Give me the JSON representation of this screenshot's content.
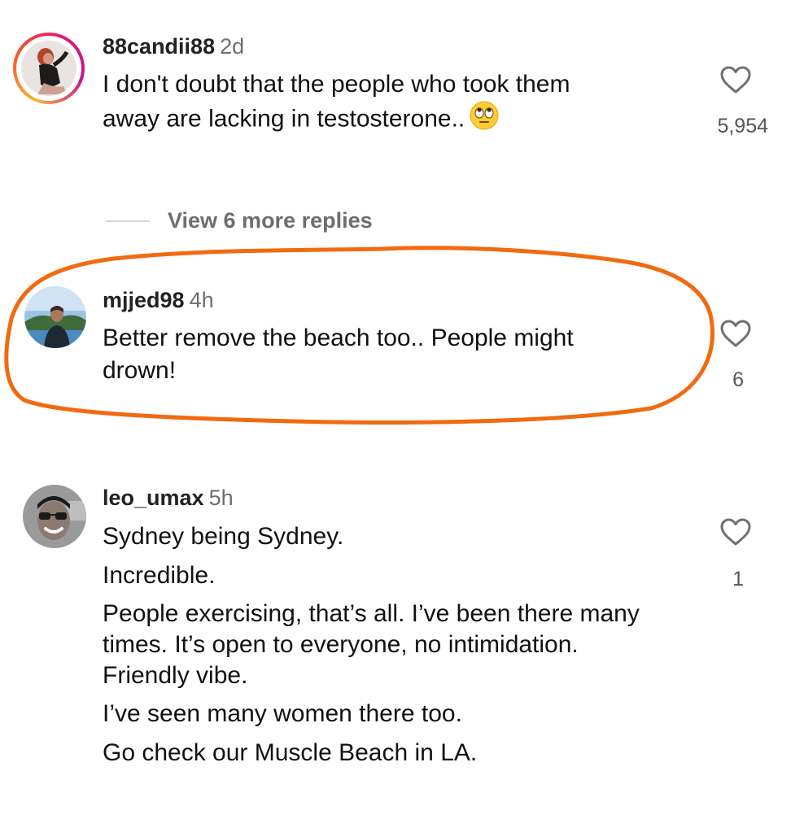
{
  "comments": [
    {
      "username": "88candii88",
      "time": "2d",
      "lines": [
        "I don't doubt that the people who took them",
        "away are lacking in testosterone.."
      ],
      "emoji": "face-with-rolling-eyes-emoji",
      "likes": "5,954",
      "has_story_ring": true
    },
    {
      "username": "mjjed98",
      "time": "4h",
      "lines": [
        "Better remove the beach too.. People might",
        "drown!"
      ],
      "likes": "6",
      "highlighted": true,
      "highlight_color": "#f26a10"
    },
    {
      "username": "leo_umax",
      "time": "5h",
      "paragraphs": [
        "Sydney being Sydney.",
        "Incredible.",
        "People exercising, that’s all. I’ve been there many times. It’s open to everyone, no intimidation. Friendly vibe.",
        "I’ve seen many women there too.",
        "Go check our Muscle Beach in LA."
      ],
      "likes": "1"
    }
  ],
  "view_replies": "View 6 more replies",
  "icons": {
    "like": "heart-outline-icon"
  },
  "colors": {
    "text": "#111111",
    "muted": "#6e6e6e",
    "annotation": "#f26a10"
  }
}
